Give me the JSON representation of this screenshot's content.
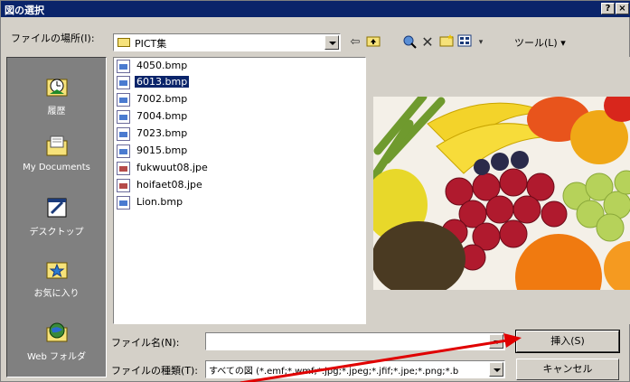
{
  "window": {
    "title": "図の選択",
    "help_label": "?",
    "close_label": "×"
  },
  "location": {
    "label": "ファイルの場所(I):",
    "value": "PICT集"
  },
  "toolbar": {
    "icons": [
      "back-icon",
      "up-folder-icon",
      "search-web-icon",
      "delete-icon",
      "new-folder-icon",
      "views-icon"
    ],
    "tools_label": "ツール(L)"
  },
  "places": [
    {
      "label": "履歴",
      "icon": "history-icon"
    },
    {
      "label": "My Documents",
      "icon": "my-documents-icon"
    },
    {
      "label": "デスクトップ",
      "icon": "desktop-icon"
    },
    {
      "label": "お気に入り",
      "icon": "favorites-icon"
    },
    {
      "label": "Web フォルダ",
      "icon": "web-folders-icon"
    }
  ],
  "files": [
    {
      "name": "4050.bmp",
      "type": "bmp",
      "selected": false
    },
    {
      "name": "6013.bmp",
      "type": "bmp",
      "selected": true
    },
    {
      "name": "7002.bmp",
      "type": "bmp",
      "selected": false
    },
    {
      "name": "7004.bmp",
      "type": "bmp",
      "selected": false
    },
    {
      "name": "7023.bmp",
      "type": "bmp",
      "selected": false
    },
    {
      "name": "9015.bmp",
      "type": "bmp",
      "selected": false
    },
    {
      "name": "fukwuut08.jpe",
      "type": "jpe",
      "selected": false
    },
    {
      "name": "hoifaet08.jpe",
      "type": "jpe",
      "selected": false
    },
    {
      "name": "Lion.bmp",
      "type": "bmp",
      "selected": false
    }
  ],
  "filename": {
    "label": "ファイル名(N):",
    "value": ""
  },
  "filetype": {
    "label": "ファイルの種類(T):",
    "value": "すべての図 (*.emf;*.wmf;*.jpg;*.jpeg;*.jfif;*.jpe;*.png;*.b"
  },
  "buttons": {
    "insert": "挿入(S)",
    "cancel": "キャンセル"
  },
  "colors": {
    "titlebar": "#0a246a",
    "selection": "#0a246a",
    "arrow": "#e00000"
  }
}
